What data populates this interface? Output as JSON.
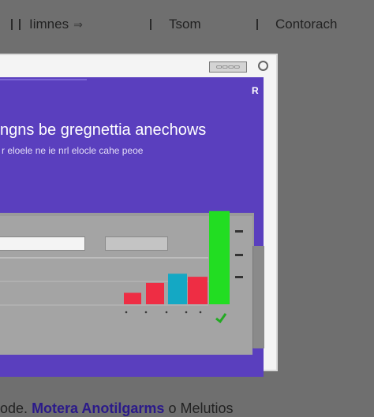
{
  "tabs": [
    {
      "label": ""
    },
    {
      "label": "Iimnes",
      "arrow_icon": "arrow-right-icon"
    },
    {
      "label": "Tsom"
    },
    {
      "label": "Contorach"
    }
  ],
  "window": {
    "button_label": "▭▭▭▭",
    "close_icon": "circle-icon"
  },
  "hero": {
    "title": "ngns be gregnettia anechows",
    "subtitle": "r eloele ne ie nrl elocle cahe peoe",
    "corner_mark": "R"
  },
  "footer": {
    "prefix": "ode.",
    "strong": "Motera Anotilgarms",
    "suffix": "o Melutios"
  },
  "chart_data": {
    "type": "bar",
    "categories": [
      "1",
      "2",
      "3",
      "4",
      "5"
    ],
    "values": [
      15,
      28,
      40,
      36,
      122
    ],
    "colors": [
      "#ee2d44",
      "#ee2d44",
      "#14a8c4",
      "#ee2d44",
      "#22dd22"
    ],
    "ylim": [
      0,
      130
    ],
    "title": "",
    "xlabel": "",
    "ylabel": ""
  }
}
